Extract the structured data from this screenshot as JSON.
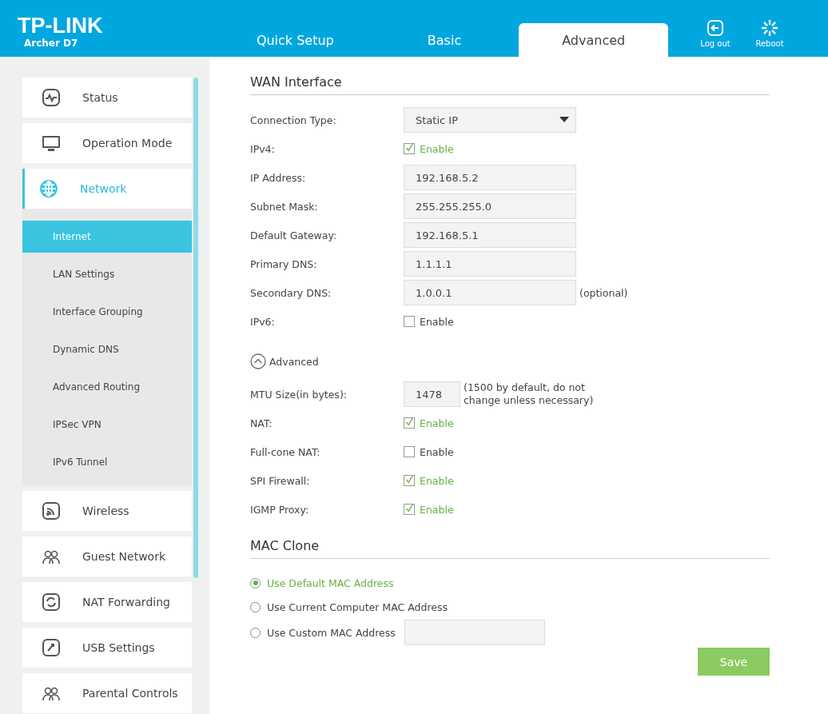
{
  "header": {
    "logo": "TP-LINK",
    "model": "Archer D7",
    "tabs": [
      {
        "label": "Quick Setup",
        "selected": false
      },
      {
        "label": "Basic",
        "selected": false
      },
      {
        "label": "Advanced",
        "selected": true
      }
    ],
    "actions": [
      {
        "label": "Log out"
      },
      {
        "label": "Reboot"
      }
    ]
  },
  "sidebar": {
    "items": [
      {
        "label": "Status",
        "selected": false
      },
      {
        "label": "Operation Mode",
        "selected": false
      },
      {
        "label": "Network",
        "selected": true,
        "expanded": true,
        "children": [
          {
            "label": "Internet",
            "selected": true
          },
          {
            "label": "LAN Settings",
            "selected": false
          },
          {
            "label": "Interface Grouping",
            "selected": false
          },
          {
            "label": "Dynamic DNS",
            "selected": false
          },
          {
            "label": "Advanced Routing",
            "selected": false
          },
          {
            "label": "IPSec VPN",
            "selected": false
          },
          {
            "label": "IPv6 Tunnel",
            "selected": false
          }
        ]
      },
      {
        "label": "Wireless",
        "selected": false
      },
      {
        "label": "Guest Network",
        "selected": false
      },
      {
        "label": "NAT Forwarding",
        "selected": false
      },
      {
        "label": "USB Settings",
        "selected": false
      },
      {
        "label": "Parental Controls",
        "selected": false
      }
    ]
  },
  "wan": {
    "title": "WAN Interface",
    "rows": [
      {
        "kind": "select",
        "label": "Connection Type:",
        "value": "Static IP"
      },
      {
        "kind": "checkbox",
        "label": "IPv4:",
        "option": "Enable",
        "checked": true
      },
      {
        "kind": "input",
        "label": "IP Address:",
        "value": "192.168.5.2"
      },
      {
        "kind": "input",
        "label": "Subnet Mask:",
        "value": "255.255.255.0"
      },
      {
        "kind": "input",
        "label": "Default Gateway:",
        "value": "192.168.5.1"
      },
      {
        "kind": "input",
        "label": "Primary DNS:",
        "value": "1.1.1.1"
      },
      {
        "kind": "input",
        "label": "Secondary DNS:",
        "value": "1.0.0.1",
        "note": "(optional)"
      },
      {
        "kind": "checkbox",
        "label": "IPv6:",
        "option": "Enable",
        "checked": false
      }
    ],
    "advanced_toggle": {
      "label": "Advanced",
      "expanded": true
    },
    "advanced_rows": [
      {
        "kind": "small-input",
        "label": "MTU Size(in bytes):",
        "value": "1478",
        "note": "(1500 by default, do not change unless necessary)"
      },
      {
        "kind": "checkbox",
        "label": "NAT:",
        "option": "Enable",
        "checked": true
      },
      {
        "kind": "checkbox",
        "label": "Full-cone NAT:",
        "option": "Enable",
        "checked": false
      },
      {
        "kind": "checkbox",
        "label": "SPI Firewall:",
        "option": "Enable",
        "checked": true
      },
      {
        "kind": "checkbox",
        "label": "IGMP Proxy:",
        "option": "Enable",
        "checked": true
      }
    ]
  },
  "mac_clone": {
    "title": "MAC Clone",
    "options": [
      {
        "label": "Use Default MAC Address",
        "selected": true
      },
      {
        "label": "Use Current Computer MAC Address",
        "selected": false
      },
      {
        "label": "Use Custom MAC Address",
        "selected": false,
        "field": true
      }
    ]
  },
  "save_button": "Save"
}
